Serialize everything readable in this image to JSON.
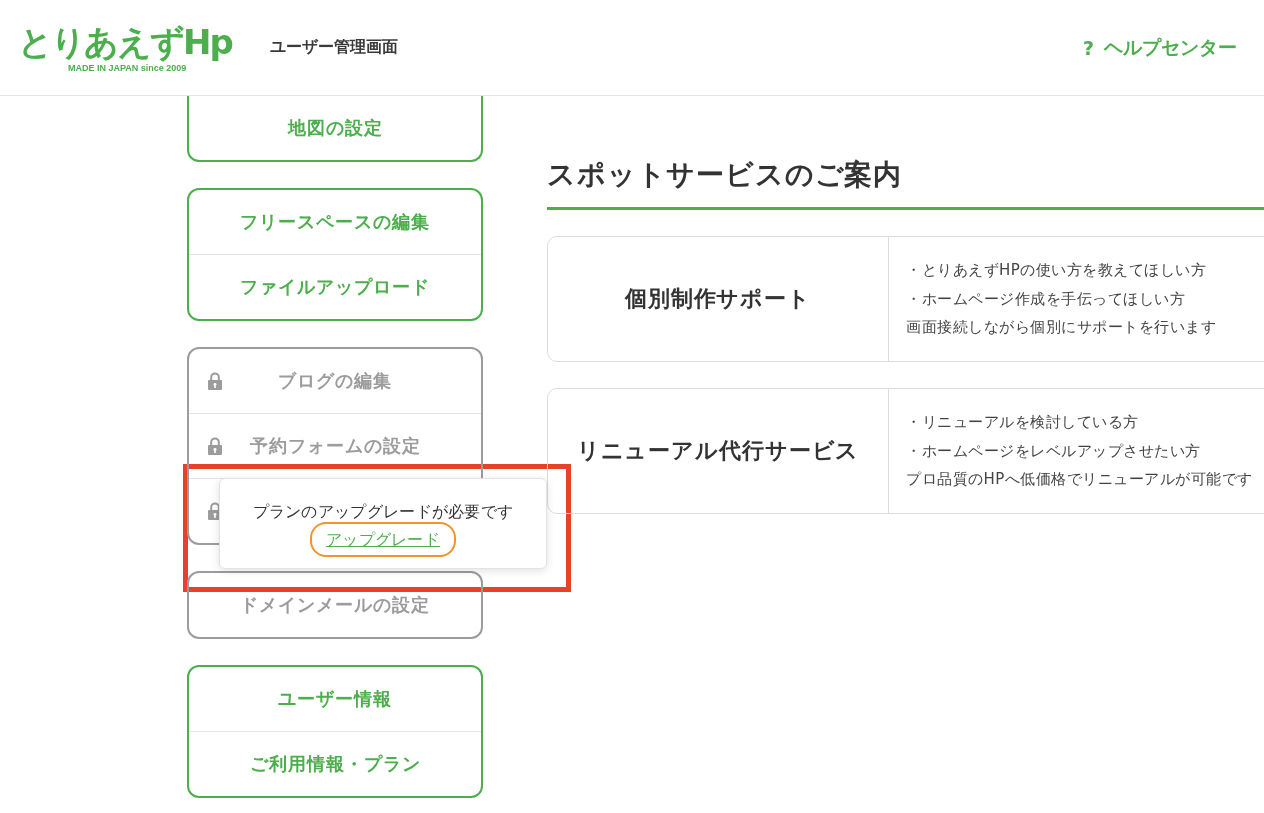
{
  "header": {
    "logo": {
      "name": "とりあえずHp",
      "tagline": "MADE IN JAPAN since 2009"
    },
    "title": "ユーザー管理画面",
    "help": {
      "icon": "?",
      "label": "ヘルプセンター"
    }
  },
  "sidebar": {
    "groups": [
      {
        "disabled": false,
        "items": [
          {
            "label": "地図の設定",
            "locked": false
          }
        ]
      },
      {
        "disabled": false,
        "items": [
          {
            "label": "フリースペースの編集",
            "locked": false
          },
          {
            "label": "ファイルアップロード",
            "locked": false
          }
        ]
      },
      {
        "disabled": true,
        "items": [
          {
            "label": "ブログの編集",
            "locked": true
          },
          {
            "label": "予約フォームの設定",
            "locked": true
          },
          {
            "locked": true,
            "popup": {
              "message": "プランのアップグレードが必要です",
              "link": {
                "label": "アップグレード",
                "focused": true
              },
              "highlighted": true
            }
          }
        ]
      },
      {
        "disabled": true,
        "items": [
          {
            "label": "ドメインメールの設定",
            "locked": false
          }
        ]
      },
      {
        "disabled": false,
        "items": [
          {
            "label": "ユーザー情報",
            "locked": false
          },
          {
            "label": "ご利用情報・プラン",
            "locked": false
          }
        ]
      }
    ]
  },
  "main": {
    "heading": "スポットサービスのご案内",
    "services": [
      {
        "name": "個別制作サポート",
        "lines": [
          "・とりあえずHPの使い方を教えてほしい方",
          "・ホームページ作成を手伝ってほしい方",
          "画面接続しながら個別にサポートを行います"
        ]
      },
      {
        "name": "リニューアル代行サービス",
        "lines": [
          "・リニューアルを検討している方",
          "・ホームページをレベルアップさせたい方",
          "プロ品質のHPへ低価格でリニューアルが可能です"
        ]
      }
    ]
  }
}
